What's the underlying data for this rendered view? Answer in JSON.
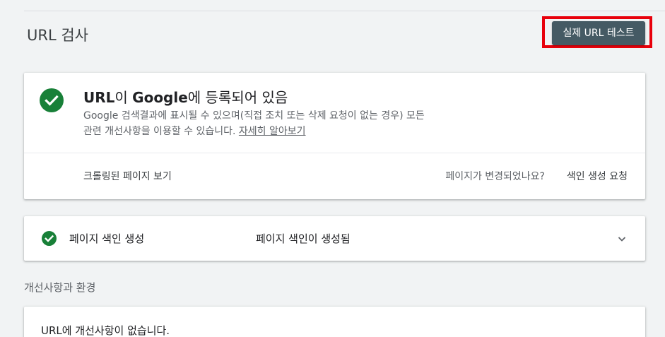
{
  "header": {
    "title": "URL 검사",
    "test_live_button_label": "실제 URL 테스트"
  },
  "status_card": {
    "heading_prefix": "URL",
    "heading_mid1": "이 ",
    "heading_brand": "Google",
    "heading_suffix": "에 등록되어 있음",
    "description_line1": "Google 검색결과에 표시될 수 있으며(직접 조치 또는 삭제 요청이 없는 경우) 모든",
    "description_line2": "관련 개선사항을 이용할 수 있습니다. ",
    "learn_more_label": "자세히 알아보기",
    "view_crawled_label": "크롤링된 페이지 보기",
    "page_changed_text": "페이지가 변경되었나요?",
    "request_indexing_label": "색인 생성 요청"
  },
  "coverage_card": {
    "label": "페이지 색인 생성",
    "value": "페이지 색인이 생성됨"
  },
  "enhancements": {
    "section_title": "개선사항과 환경",
    "message": "URL에 개선사항이 없습니다."
  },
  "icons": {
    "status": "check-circle-icon",
    "coverage_status": "check-circle-icon",
    "expand": "chevron-down-icon"
  },
  "colors": {
    "success_green": "#188038",
    "button_bg": "#455a64",
    "highlight_red": "#e8000b"
  }
}
